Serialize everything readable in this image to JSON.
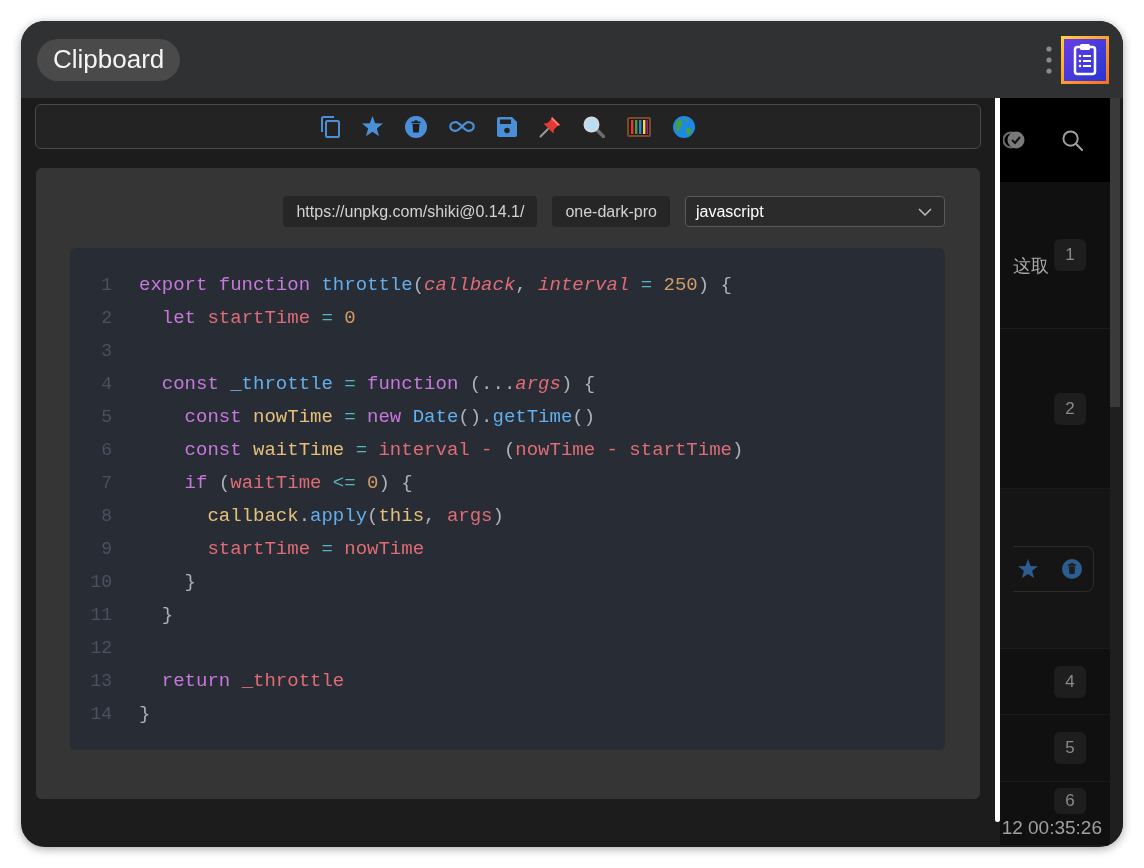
{
  "window": {
    "title": "Clipboard"
  },
  "snippet": {
    "source_url": "https://unpkg.com/shiki@0.14.1/",
    "theme": "one-dark-pro",
    "language": "javascript",
    "lines": [
      {
        "number": "1",
        "tokens": [
          {
            "text": "export function ",
            "kind": "keyword"
          },
          {
            "text": "throttle",
            "kind": "function"
          },
          {
            "text": "(",
            "kind": "plain"
          },
          {
            "text": "callback",
            "kind": "parameter"
          },
          {
            "text": ", ",
            "kind": "plain"
          },
          {
            "text": "interval ",
            "kind": "parameter"
          },
          {
            "text": "= ",
            "kind": "operator"
          },
          {
            "text": "250",
            "kind": "number"
          },
          {
            "text": ") {",
            "kind": "plain"
          }
        ]
      },
      {
        "number": "2",
        "tokens": [
          {
            "text": "  let ",
            "kind": "keyword"
          },
          {
            "text": "startTime ",
            "kind": "variable"
          },
          {
            "text": "= ",
            "kind": "operator"
          },
          {
            "text": "0",
            "kind": "number"
          }
        ]
      },
      {
        "number": "3"
      },
      {
        "number": "4",
        "tokens": [
          {
            "text": "  const ",
            "kind": "keyword"
          },
          {
            "text": "_throttle ",
            "kind": "function"
          },
          {
            "text": "= ",
            "kind": "operator"
          },
          {
            "text": "function ",
            "kind": "keyword"
          },
          {
            "text": "(...",
            "kind": "plain"
          },
          {
            "text": "args",
            "kind": "parameter"
          },
          {
            "text": ") {",
            "kind": "plain"
          }
        ]
      },
      {
        "number": "5",
        "tokens": [
          {
            "text": "    const ",
            "kind": "keyword"
          },
          {
            "text": "nowTime ",
            "kind": "constant"
          },
          {
            "text": "= ",
            "kind": "operator"
          },
          {
            "text": "new ",
            "kind": "keyword"
          },
          {
            "text": "Date",
            "kind": "function"
          },
          {
            "text": "().",
            "kind": "plain"
          },
          {
            "text": "getTime",
            "kind": "function"
          },
          {
            "text": "()",
            "kind": "plain"
          }
        ]
      },
      {
        "number": "6",
        "tokens": [
          {
            "text": "    const ",
            "kind": "keyword"
          },
          {
            "text": "waitTime ",
            "kind": "constant"
          },
          {
            "text": "= ",
            "kind": "operator"
          },
          {
            "text": "interval ",
            "kind": "variable"
          },
          {
            "text": "- ",
            "kind": "arithmetic"
          },
          {
            "text": "(",
            "kind": "plain"
          },
          {
            "text": "nowTime ",
            "kind": "variable"
          },
          {
            "text": "- ",
            "kind": "arithmetic"
          },
          {
            "text": "startTime",
            "kind": "variable"
          },
          {
            "text": ")",
            "kind": "plain"
          }
        ]
      },
      {
        "number": "7",
        "tokens": [
          {
            "text": "    if ",
            "kind": "keyword"
          },
          {
            "text": "(",
            "kind": "plain"
          },
          {
            "text": "waitTime ",
            "kind": "variable"
          },
          {
            "text": "<= ",
            "kind": "operator"
          },
          {
            "text": "0",
            "kind": "number"
          },
          {
            "text": ") {",
            "kind": "plain"
          }
        ]
      },
      {
        "number": "8",
        "tokens": [
          {
            "text": "      callback",
            "kind": "constant"
          },
          {
            "text": ".",
            "kind": "plain"
          },
          {
            "text": "apply",
            "kind": "function"
          },
          {
            "text": "(",
            "kind": "plain"
          },
          {
            "text": "this",
            "kind": "constant"
          },
          {
            "text": ", ",
            "kind": "plain"
          },
          {
            "text": "args",
            "kind": "variable"
          },
          {
            "text": ")",
            "kind": "plain"
          }
        ]
      },
      {
        "number": "9",
        "tokens": [
          {
            "text": "      startTime ",
            "kind": "variable"
          },
          {
            "text": "= ",
            "kind": "operator"
          },
          {
            "text": "nowTime",
            "kind": "variable"
          }
        ]
      },
      {
        "number": "10",
        "tokens": [
          {
            "text": "    }",
            "kind": "plain"
          }
        ]
      },
      {
        "number": "11",
        "tokens": [
          {
            "text": "  }",
            "kind": "plain"
          }
        ]
      },
      {
        "number": "12"
      },
      {
        "number": "13",
        "tokens": [
          {
            "text": "  return ",
            "kind": "keyword"
          },
          {
            "text": "_throttle",
            "kind": "variable"
          }
        ]
      },
      {
        "number": "14",
        "tokens": [
          {
            "text": "}",
            "kind": "plain"
          }
        ]
      }
    ]
  },
  "history": {
    "items": [
      {
        "index": "1",
        "preview": "这取",
        "hovered": false
      },
      {
        "index": "2",
        "hovered": false
      },
      {
        "hovered": true
      },
      {
        "index": "4",
        "hovered": false
      },
      {
        "index": "5",
        "hovered": false
      },
      {
        "index": "6",
        "hovered": false,
        "time": "12 00:35:26"
      }
    ]
  }
}
